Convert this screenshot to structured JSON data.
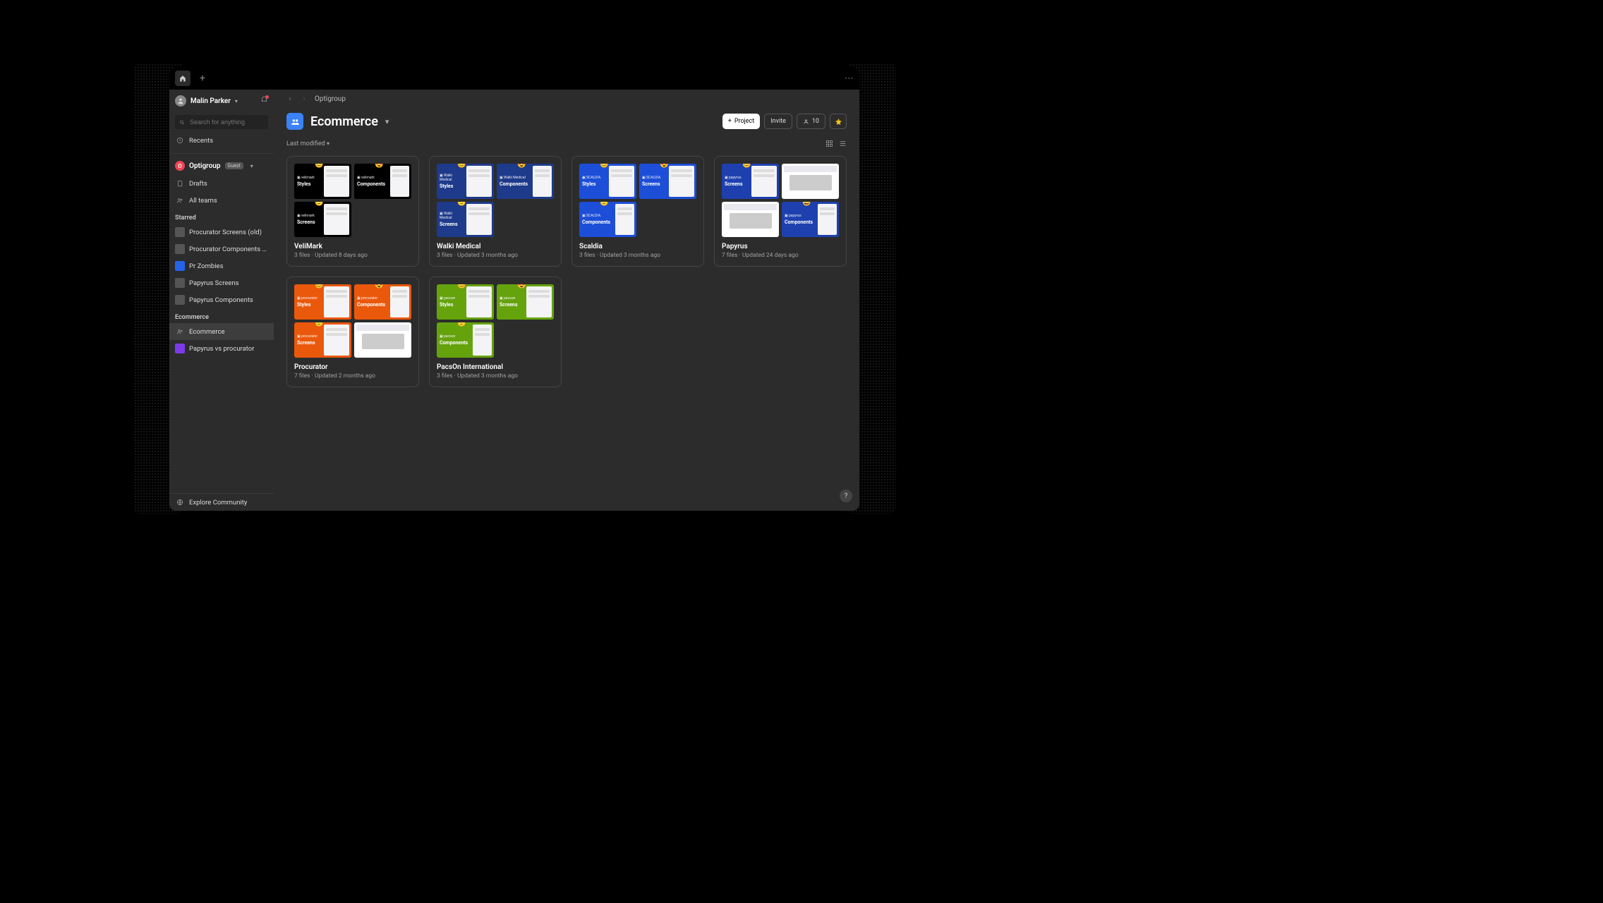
{
  "user": {
    "name": "Malin Parker"
  },
  "search": {
    "placeholder": "Search for anything"
  },
  "nav": {
    "recents": "Recents"
  },
  "org": {
    "name": "Optigroup",
    "badge": "Guest",
    "drafts": "Drafts",
    "allTeams": "All teams"
  },
  "sections": {
    "starred": "Starred",
    "ecommerce": "Ecommerce"
  },
  "starred": [
    {
      "label": "Procurator Screens (old)",
      "color": "#555"
    },
    {
      "label": "Procurator Components (old)",
      "color": "#555"
    },
    {
      "label": "Pr Zombies",
      "color": "#2563eb"
    },
    {
      "label": "Papyrus Screens",
      "color": "#555"
    },
    {
      "label": "Papyrus Components",
      "color": "#555"
    }
  ],
  "teamProjects": [
    {
      "label": "Ecommerce",
      "icon": "people",
      "selected": true
    },
    {
      "label": "Papyrus vs procurator",
      "color": "#7c3aed"
    }
  ],
  "footer": {
    "explore": "Explore Community"
  },
  "breadcrumb": {
    "org": "Optigroup"
  },
  "page": {
    "title": "Ecommerce"
  },
  "actions": {
    "project": "Project",
    "invite": "Invite",
    "members": "10"
  },
  "sort": {
    "label": "Last modified"
  },
  "projects": [
    {
      "title": "VeliMark",
      "meta": "3 files · Updated 8 days ago",
      "color": "#000000",
      "brand": "velimark",
      "tiles": [
        "Styles",
        "Components",
        "Screens",
        null
      ]
    },
    {
      "title": "Walki Medical",
      "meta": "3 files · Updated 3 months ago",
      "color": "#1e3a8a",
      "brand": "Walki Medical",
      "tiles": [
        "Styles",
        "Components",
        "Screens",
        null
      ]
    },
    {
      "title": "Scaldia",
      "meta": "3 files · Updated 3 months ago",
      "color": "#1d4ed8",
      "brand": "SCALDIA.",
      "tiles": [
        "Styles",
        "Screens",
        "Components",
        null
      ]
    },
    {
      "title": "Papyrus",
      "meta": "7 files · Updated 24 days ago",
      "color": "#1e40af",
      "brand": "papyrus",
      "tiles": [
        "Screens",
        "shot",
        "shot",
        "Components"
      ],
      "special": true
    },
    {
      "title": "Procurator",
      "meta": "7 files · Updated 2 months ago",
      "color": "#ea580c",
      "brand": "procurator",
      "tiles": [
        "Styles",
        "Components",
        "Screens",
        "shot"
      ]
    },
    {
      "title": "PacsOn International",
      "meta": "3 files · Updated 3 months ago",
      "color": "#65a30d",
      "brand": "pacson",
      "tiles": [
        "Styles",
        "Screens",
        "Components",
        null
      ]
    }
  ]
}
